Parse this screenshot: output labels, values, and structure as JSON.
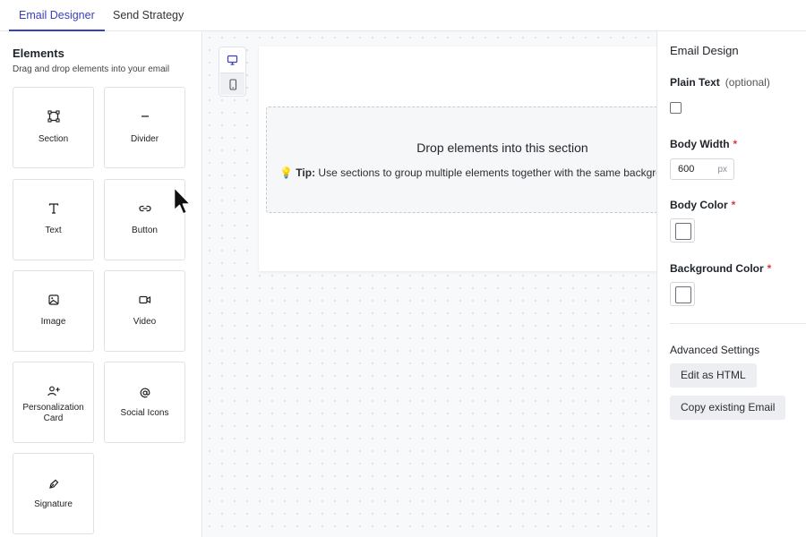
{
  "tabs": [
    {
      "label": "Email Designer",
      "active": true
    },
    {
      "label": "Send Strategy",
      "active": false
    }
  ],
  "elements_panel": {
    "title": "Elements",
    "subtitle": "Drag and drop elements into your email",
    "items": [
      {
        "label": "Section",
        "icon": "section-icon"
      },
      {
        "label": "Divider",
        "icon": "divider-icon"
      },
      {
        "label": "Text",
        "icon": "text-icon"
      },
      {
        "label": "Button",
        "icon": "link-icon"
      },
      {
        "label": "Image",
        "icon": "image-icon"
      },
      {
        "label": "Video",
        "icon": "video-icon"
      },
      {
        "label": "Personalization Card",
        "icon": "user-plus-icon"
      },
      {
        "label": "Social Icons",
        "icon": "at-icon"
      },
      {
        "label": "Signature",
        "icon": "pen-icon"
      }
    ]
  },
  "canvas": {
    "device_toggle": [
      "desktop-icon",
      "mobile-icon"
    ],
    "drop_title": "Drop elements into this section",
    "tip_label": "Tip:",
    "tip_text": "Use sections to group multiple elements together with the same background"
  },
  "design_panel": {
    "title": "Email Design",
    "plain_text_label": "Plain Text",
    "plain_text_optional": "(optional)",
    "body_width_label": "Body Width",
    "body_width_value": "600",
    "body_width_unit": "px",
    "body_color_label": "Body Color",
    "background_color_label": "Background Color",
    "required_mark": "*",
    "advanced_title": "Advanced Settings",
    "edit_html_button": "Edit as HTML",
    "copy_email_button": "Copy existing Email"
  },
  "colors": {
    "accent": "#3b3fb8",
    "required": "#d63a3a"
  }
}
